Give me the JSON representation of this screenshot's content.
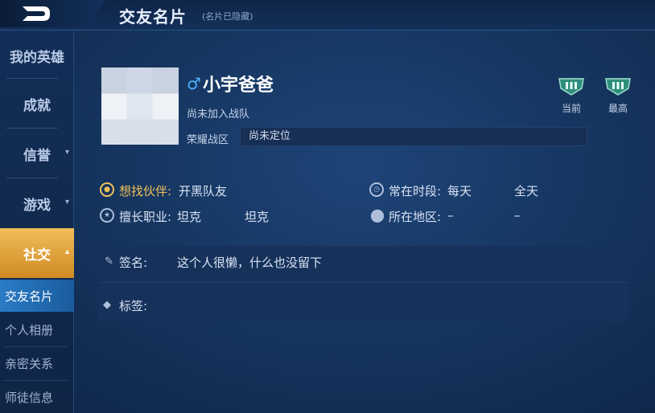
{
  "header": {
    "title": "交友名片",
    "subtitle": "(名片已隐藏)"
  },
  "sidebar": {
    "items": [
      {
        "label": "我的英雄"
      },
      {
        "label": "成就"
      },
      {
        "label": "信誉"
      },
      {
        "label": "游戏"
      },
      {
        "label": "社交"
      }
    ],
    "sub_items": [
      {
        "label": "交友名片"
      },
      {
        "label": "个人相册"
      },
      {
        "label": "亲密关系"
      },
      {
        "label": "师徒信息"
      }
    ]
  },
  "profile": {
    "gender_symbol": "♂",
    "nickname": "小宇爸爸",
    "team_status": "尚未加入战队",
    "region_label": "荣耀战区",
    "region_value": "尚未定位",
    "rank_current_label": "当前",
    "rank_highest_label": "最高"
  },
  "info": {
    "partner_label": "想找伙伴:",
    "partner_value": "开黑队友",
    "time_label": "常在时段:",
    "time_value1": "每天",
    "time_value2": "全天",
    "role_label": "擅长职业:",
    "role_value1": "坦克",
    "role_value2": "坦克",
    "location_label": "所在地区:",
    "location_value1": "–",
    "location_value2": "–"
  },
  "signature": {
    "label": "签名:",
    "value": "这个人很懒，什么也没留下",
    "tags_label": "标签:"
  },
  "colors": {
    "accent_gold": "#f0c05a",
    "active_tab": "#d08a22",
    "active_subtab": "#2a7bc6",
    "gender_blue": "#4fb3ff"
  }
}
